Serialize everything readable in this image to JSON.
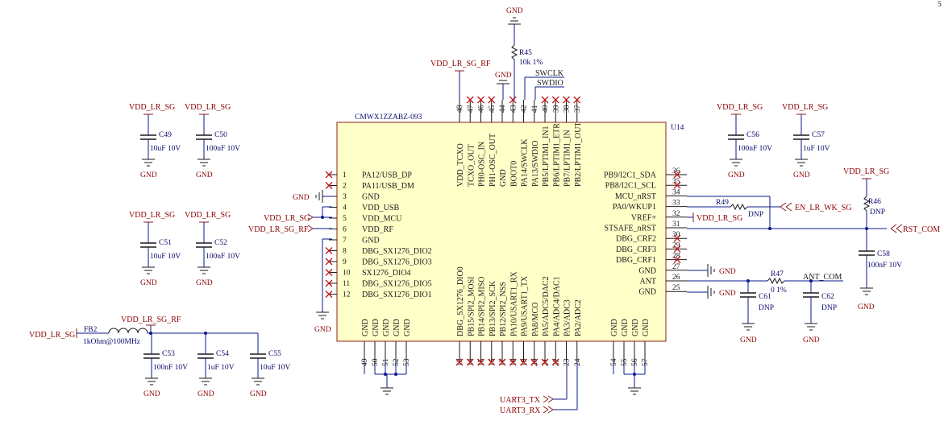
{
  "ic": {
    "designator": "U14",
    "part_number": "CMWX1ZZABZ-093",
    "left_pins": [
      {
        "n": "1",
        "name": "PA12/USB_DP"
      },
      {
        "n": "2",
        "name": "PA11/USB_DM"
      },
      {
        "n": "3",
        "name": "GND"
      },
      {
        "n": "4",
        "name": "VDD_USB"
      },
      {
        "n": "5",
        "name": "VDD_MCU"
      },
      {
        "n": "6",
        "name": "VDD_RF"
      },
      {
        "n": "7",
        "name": "GND"
      },
      {
        "n": "8",
        "name": "DBG_SX1276_DIO2"
      },
      {
        "n": "9",
        "name": "DBG_SX1276_DIO3"
      },
      {
        "n": "10",
        "name": "SX1276_DIO4"
      },
      {
        "n": "11",
        "name": "DBG_SX1276_DIO5"
      },
      {
        "n": "12",
        "name": "DBG_SX1276_DIO1"
      }
    ],
    "right_pins": [
      {
        "n": "36",
        "name": "PB9/I2C1_SDA"
      },
      {
        "n": "35",
        "name": "PB8/I2C1_SCL"
      },
      {
        "n": "34",
        "name": "MCU_nRST"
      },
      {
        "n": "33",
        "name": "PA0/WKUP1"
      },
      {
        "n": "32",
        "name": "VREF+"
      },
      {
        "n": "31",
        "name": "STSAFE_nRST"
      },
      {
        "n": "30",
        "name": "DBG_CRF2"
      },
      {
        "n": "29",
        "name": "DBG_CRF3"
      },
      {
        "n": "28",
        "name": "DBG_CRF1"
      },
      {
        "n": "27",
        "name": "GND"
      },
      {
        "n": "26",
        "name": "ANT"
      },
      {
        "n": "25",
        "name": "GND"
      }
    ],
    "top_pins": [
      {
        "n": "48",
        "name": "VDD_TCXO"
      },
      {
        "n": "47",
        "name": "TCXO_OUT"
      },
      {
        "n": "46",
        "name": "PH0-OSC_IN"
      },
      {
        "n": "45",
        "name": "PH1-OSC_OUT"
      },
      {
        "n": "44",
        "name": "GND"
      },
      {
        "n": "43",
        "name": "BOOT0"
      },
      {
        "n": "42",
        "name": "PA14/SWCLK"
      },
      {
        "n": "41",
        "name": "PA13/SWDIO"
      },
      {
        "n": "40",
        "name": "PB5/LPTIM1_IN1"
      },
      {
        "n": "39",
        "name": "PB6/LPTIM1_ETR"
      },
      {
        "n": "38",
        "name": "PB7/LPTIM1_IN"
      },
      {
        "n": "37",
        "name": "PB2/LPTIM1_OUT"
      }
    ],
    "bottom_left_pins": [
      {
        "n": "49",
        "name": "GND"
      },
      {
        "n": "50",
        "name": "GND"
      },
      {
        "n": "51",
        "name": "GND"
      },
      {
        "n": "52",
        "name": "GND"
      },
      {
        "n": "53",
        "name": "GND"
      }
    ],
    "bottom_mid_pins": [
      {
        "n": "13",
        "name": "DBG_SX1276_DIO0"
      },
      {
        "n": "14",
        "name": "PB15/SPI2_MOSI"
      },
      {
        "n": "15",
        "name": "PB14/SPI2_MISO"
      },
      {
        "n": "16",
        "name": "PB13/SPI2_SCK"
      },
      {
        "n": "17",
        "name": "PB12/SPI2_NSS"
      },
      {
        "n": "18",
        "name": "PA10/USART1_RX"
      },
      {
        "n": "19",
        "name": "PA9/USART1_TX"
      },
      {
        "n": "20",
        "name": "PA8/MCO"
      },
      {
        "n": "21",
        "name": "PA5/ADC5/DAC2"
      },
      {
        "n": "22",
        "name": "PA4/ADC4/DAC1"
      },
      {
        "n": "23",
        "name": "PA3/ADC3"
      },
      {
        "n": "24",
        "name": "PA2/ADC2"
      }
    ],
    "bottom_right_pins": [
      {
        "n": "54",
        "name": "GND"
      },
      {
        "n": "55",
        "name": "GND"
      },
      {
        "n": "56",
        "name": "GND"
      },
      {
        "n": "57",
        "name": "GND"
      }
    ]
  },
  "caps": [
    {
      "id": "c49",
      "ref": "C49",
      "val": "10uF 10V",
      "net": "VDD_LR_SG"
    },
    {
      "id": "c50",
      "ref": "C50",
      "val": "100nF 10V",
      "net": "VDD_LR_SG"
    },
    {
      "id": "c51",
      "ref": "C51",
      "val": "10uF 10V",
      "net": "VDD_LR_SG"
    },
    {
      "id": "c52",
      "ref": "C52",
      "val": "100nF 10V",
      "net": "VDD_LR_SG"
    },
    {
      "id": "c53",
      "ref": "C53",
      "val": "100nF 10V"
    },
    {
      "id": "c54",
      "ref": "C54",
      "val": "1uF 10V"
    },
    {
      "id": "c55",
      "ref": "C55",
      "val": "10uF 10V"
    },
    {
      "id": "c56",
      "ref": "C56",
      "val": "100nF 10V",
      "net": "VDD_LR_SG"
    },
    {
      "id": "c57",
      "ref": "C57",
      "val": "1uF 10V",
      "net": "VDD_LR_SG"
    },
    {
      "id": "c58",
      "ref": "C58",
      "val": "100nF 10V"
    },
    {
      "id": "c61",
      "ref": "C61",
      "val": "DNP"
    },
    {
      "id": "c62",
      "ref": "C62",
      "val": "DNP"
    }
  ],
  "resistors": [
    {
      "id": "r45",
      "ref": "R45",
      "val": "10k 1%"
    },
    {
      "id": "r46",
      "ref": "R46",
      "val": "DNP"
    },
    {
      "id": "r47",
      "ref": "R47",
      "val": "0 1%"
    },
    {
      "id": "r49",
      "ref": "R49",
      "val": "DNP"
    }
  ],
  "ferrite": {
    "ref": "FB2",
    "val": "1kOhm@100MHz"
  },
  "gnd_label": "GND",
  "nets": {
    "vdd_lr_sg": "VDD_LR_SG",
    "vdd_lr_sg_rf": "VDD_LR_SG_RF",
    "swclk": "SWCLK",
    "swdio": "SWDIO",
    "ant_com": "ANT_COM",
    "en_lr_wk_sg": "EN_LR_WK_SG",
    "rst_com": "RST_COM",
    "uart3_tx": "UART3_TX",
    "uart3_rx": "UART3_RX"
  },
  "corner_mark": "5",
  "colors": {
    "label": "#8b0000",
    "body_fill": "#ffffc8",
    "body_stroke": "#8b2020",
    "wire": "#0a1a8c",
    "nc": "#c01818"
  }
}
